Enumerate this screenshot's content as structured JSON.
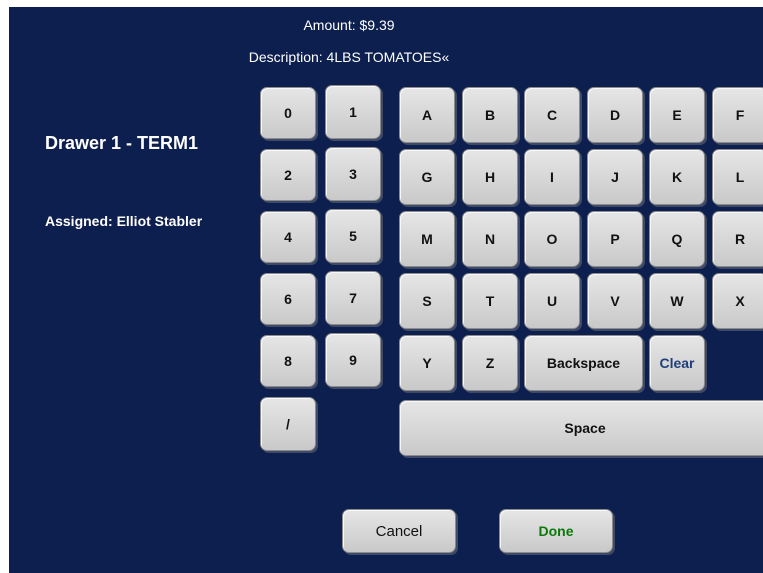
{
  "header": {
    "amount": "Amount: $9.39",
    "description": "Description: 4LBS TOMATOES«"
  },
  "drawer": {
    "title": "Drawer 1 - TERM1",
    "assigned": "Assigned: Elliot Stabler"
  },
  "keypad": {
    "numeric": [
      "0",
      "1",
      "2",
      "3",
      "4",
      "5",
      "6",
      "7",
      "8",
      "9",
      "/"
    ],
    "letters": [
      "A",
      "B",
      "C",
      "D",
      "E",
      "F",
      "G",
      "H",
      "I",
      "J",
      "K",
      "L",
      "M",
      "N",
      "O",
      "P",
      "Q",
      "R",
      "S",
      "T",
      "U",
      "V",
      "W",
      "X",
      "Y",
      "Z"
    ],
    "backspace": "Backspace",
    "clear": "Clear",
    "space": "Space"
  },
  "actions": {
    "cancel": "Cancel",
    "done": "Done"
  },
  "colors": {
    "background": "#0d1f4e",
    "key": "#d6d6d6",
    "clear_text": "#1f3e7a",
    "done_text": "#0b7a0b"
  }
}
